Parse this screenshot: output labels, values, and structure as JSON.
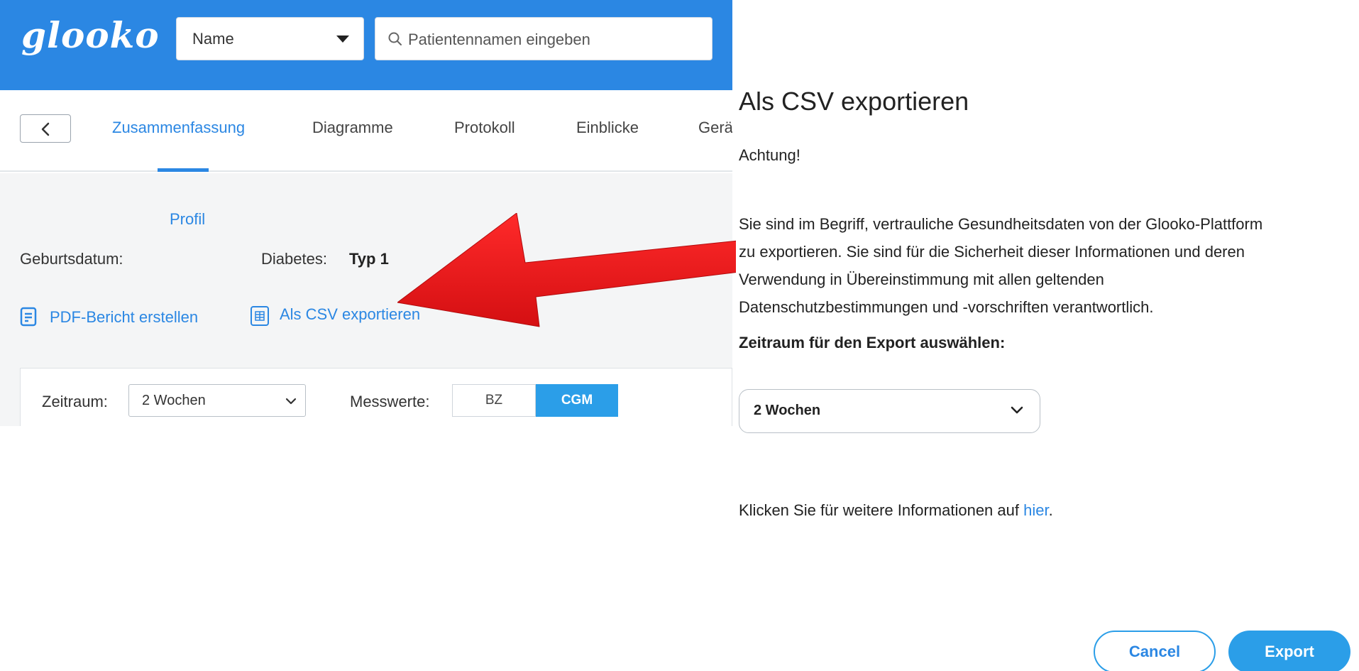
{
  "header": {
    "logo": "glooko",
    "search_type": "Name",
    "search_placeholder": "Patientennamen eingeben"
  },
  "nav": {
    "tabs": [
      "Zusammenfassung",
      "Diagramme",
      "Protokoll",
      "Einblicke",
      "Geräte"
    ]
  },
  "profile": {
    "profil_label": "Profil",
    "geburtsdatum_label": "Geburtsdatum:",
    "diabetes_label": "Diabetes:",
    "diabetes_value": "Typ 1",
    "pdf_link": "PDF-Bericht erstellen",
    "csv_link": "Als CSV exportieren"
  },
  "filters": {
    "zeitraum_label": "Zeitraum:",
    "zeitraum_value": "2 Wochen",
    "messwerte_label": "Messwerte:",
    "bz_label": "BZ",
    "cgm_label": "CGM"
  },
  "dialog": {
    "title": "Als CSV exportieren",
    "warning": "Achtung!",
    "body_lines": [
      "Sie sind im Begriff, vertrauliche Gesundheitsdaten von der Glooko-Plattform",
      "zu exportieren. Sie sind für die Sicherheit dieser Informationen und deren",
      "Verwendung in Übereinstimmung mit allen geltenden",
      "Datenschutzbestimmungen und -vorschriften verantwortlich."
    ],
    "range_label": "Zeitraum für den Export auswählen:",
    "range_value": "2 Wochen",
    "info_text": "Klicken Sie für weitere Informationen auf ",
    "info_link": "hier",
    "info_suffix": ".",
    "cancel_label": "Cancel",
    "export_label": "Export"
  },
  "colors": {
    "brand_blue": "#2b87e3",
    "button_blue": "#2b9ee8",
    "arrow_red": "#e8191c"
  },
  "icons": [
    "chevron-down-icon",
    "search-icon",
    "chevron-left-icon",
    "document-icon",
    "table-icon",
    "red-arrow-annotation"
  ]
}
